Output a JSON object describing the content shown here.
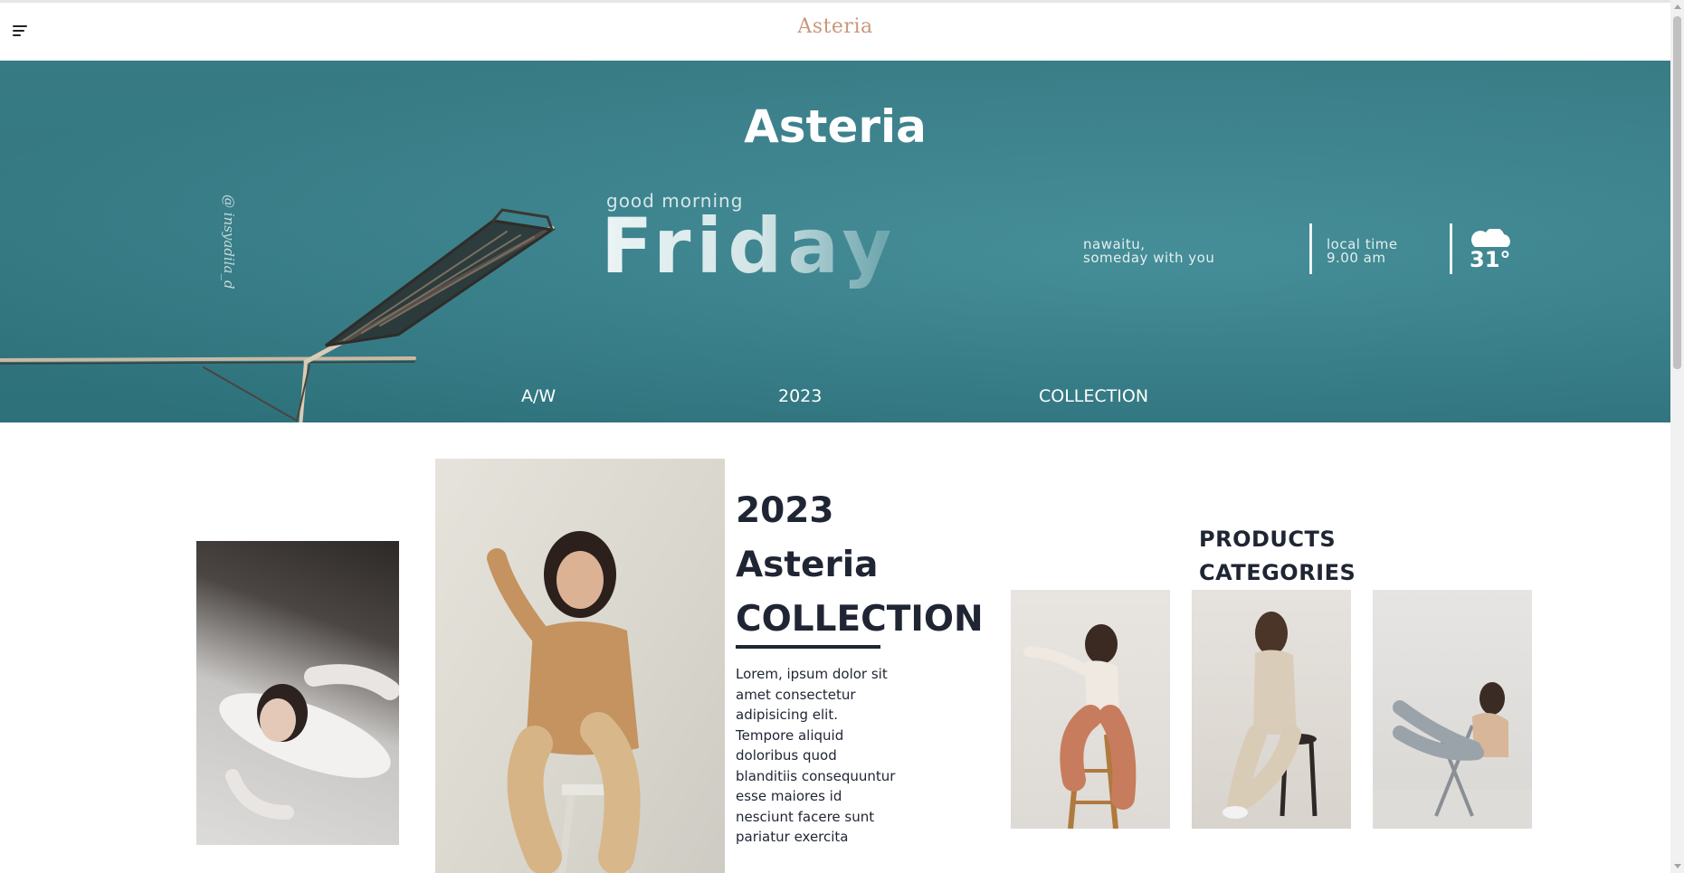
{
  "header": {
    "logo": "Asteria",
    "menu_icon": "hamburger-menu-icon"
  },
  "hero": {
    "title": "Asteria",
    "instagram_handle": "@ insyadila_d",
    "greeting": "good morning",
    "day": "Friday",
    "location_line1": "nawaitu,",
    "location_line2": "someday with you",
    "time_label": "local time",
    "time_value": "9.00 am",
    "weather_icon": "cloud-icon",
    "temperature": "31°",
    "tags": [
      "A/W",
      "2023",
      "COLLECTION"
    ],
    "colors": {
      "background": "#3b8893"
    }
  },
  "collection": {
    "title_lines": [
      "2023",
      "Asteria",
      "COLLECTION"
    ],
    "description": "Lorem, ipsum dolor sit amet consectetur adipisicing elit. Tempore aliquid doloribus quod blanditiis consequuntur esse maiores id nesciunt facere sunt pariatur exercita"
  },
  "products": {
    "title_lines": [
      "PRODUCTS",
      "CATEGORIES"
    ]
  },
  "colors": {
    "logo": "#c8987c",
    "text_dark": "#1f2533"
  }
}
